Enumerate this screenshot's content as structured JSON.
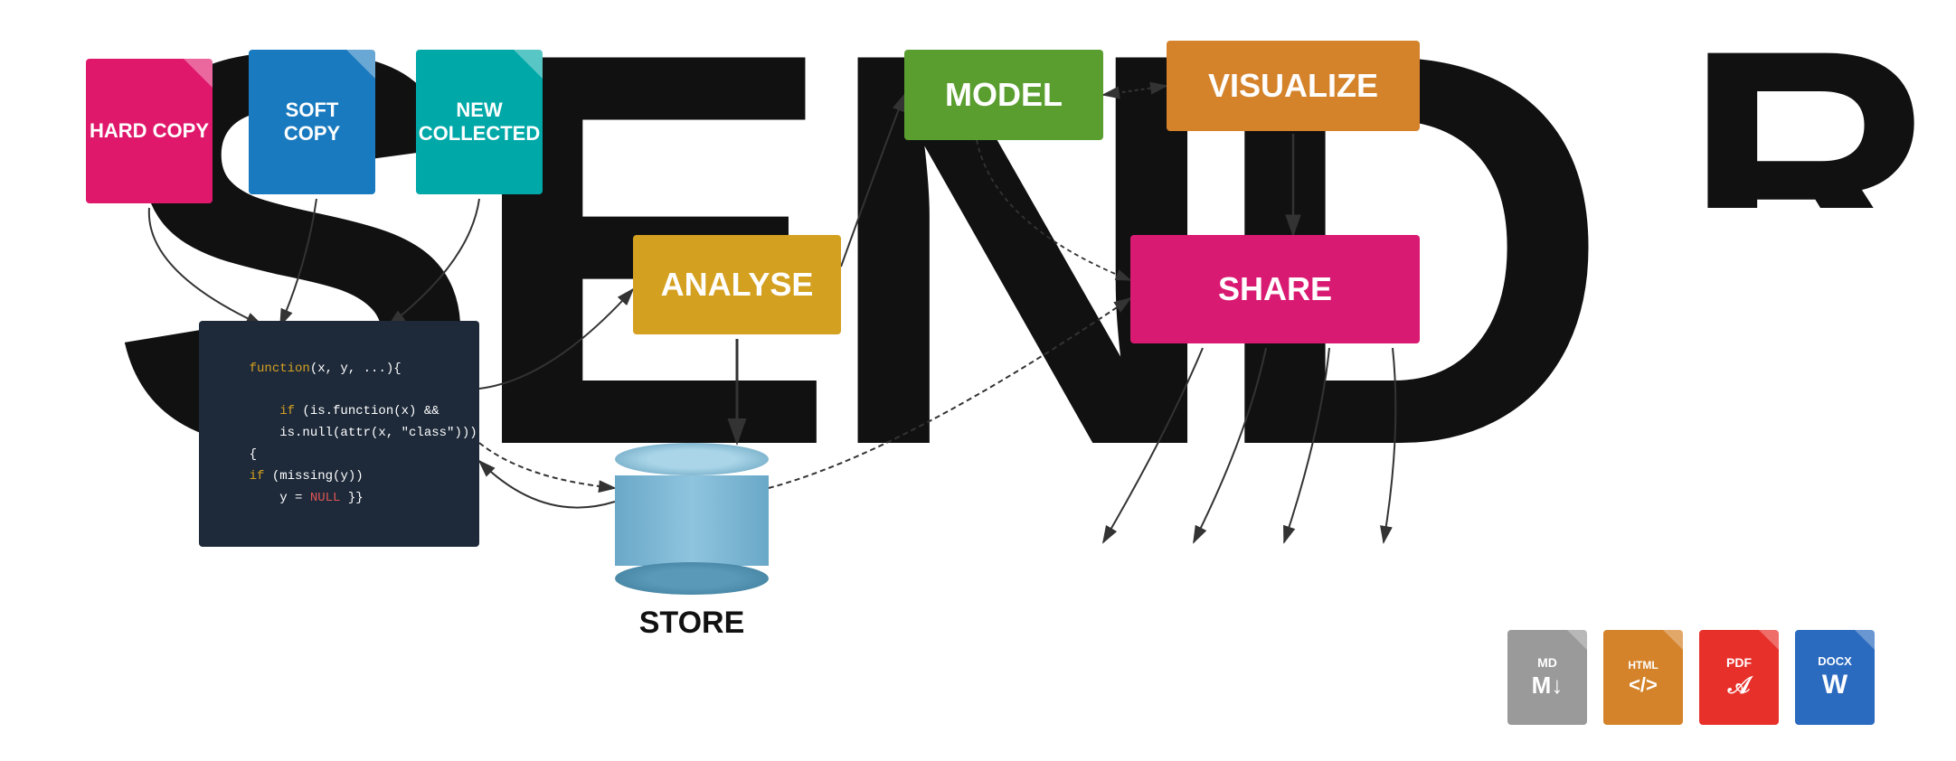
{
  "background_letters": {
    "send": "SEND",
    "r": "R"
  },
  "documents": {
    "hard_copy": {
      "label": "HARD\nCOPY",
      "color": "#e0186c"
    },
    "soft_copy": {
      "label": "SOFT\nCOPY",
      "color": "#1a7abf"
    },
    "new_collected": {
      "label": "NEW\nCOLLECTED",
      "color": "#00a8a8"
    }
  },
  "boxes": {
    "model": {
      "label": "MODEL",
      "color": "#5a9e2f"
    },
    "visualize": {
      "label": "VISUALIZE",
      "color": "#d4832a"
    },
    "analyse": {
      "label": "ANALYSE",
      "color": "#d4a020"
    },
    "share": {
      "label": "SHARE",
      "color": "#d91a72"
    }
  },
  "code_block": {
    "line1": "function(x, y, ...){",
    "line2": "    if (is.function(x) &&",
    "line3": "        is.null(attr(x, \"class\")))",
    "line4": "    {",
    "line5": "    if (missing(y))",
    "line6": "        y = NULL }}"
  },
  "store": {
    "label": "STORE"
  },
  "format_icons": [
    {
      "id": "md",
      "label": "MD",
      "symbol": "M↓",
      "color": "#9a9a9a"
    },
    {
      "id": "html",
      "label": "HTML",
      "symbol": "</>",
      "color": "#d4832a"
    },
    {
      "id": "pdf",
      "label": "PDF",
      "symbol": "PDF",
      "color": "#e8302a"
    },
    {
      "id": "docx",
      "label": "DOCX",
      "symbol": "W",
      "color": "#2a6abf"
    }
  ]
}
